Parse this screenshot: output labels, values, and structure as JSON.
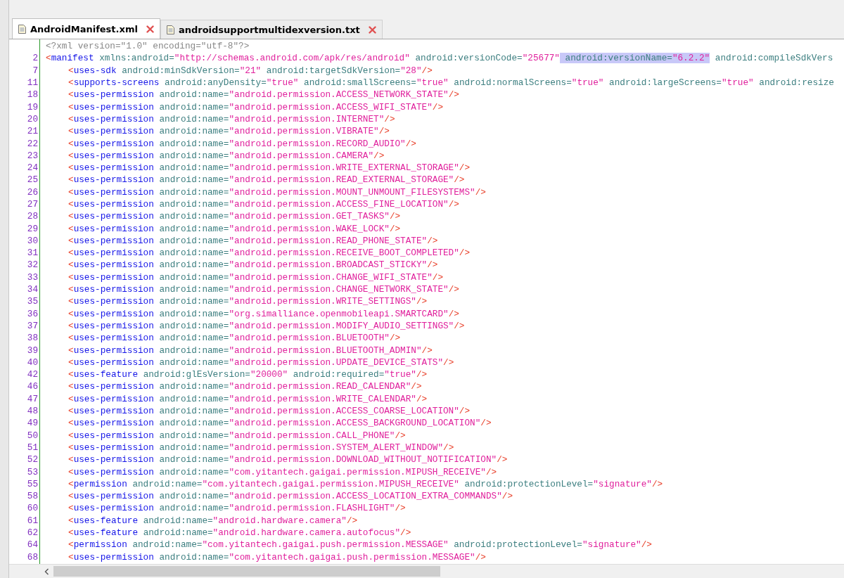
{
  "tabs": [
    {
      "label": "AndroidManifest.xml",
      "selected": true
    },
    {
      "label": "androidsupportmultidexversion.txt",
      "selected": false
    }
  ],
  "editor": {
    "lines": [
      {
        "kind": "declaration",
        "text": "<?xml version=\"1.0\" encoding=\"utf-8\"?>"
      },
      {
        "kind": "element",
        "number": "2",
        "open": "<",
        "tag": "manifest",
        "attrs": [
          {
            "name": "xmlns:android=",
            "value": "\"http://schemas.android.com/apk/res/android\"",
            "selected": false
          },
          {
            "name": "android:versionCode=",
            "value": "\"25677\"",
            "selected": false
          },
          {
            "name": "android:versionName=",
            "value": "\"6.2.2\"",
            "selected": true
          },
          {
            "name": "android:compileSdkVers",
            "selected": false
          }
        ],
        "children": [
          {
            "kind": "element",
            "number": "7",
            "open": "<",
            "tag": "uses-sdk",
            "attrs": [
              {
                "name": "android:minSdkVersion=",
                "value": "\"21\"",
                "selected": false
              },
              {
                "name": "android:targetSdkVersion=",
                "value": "\"28\"",
                "selected": false
              }
            ],
            "end": "/>"
          },
          {
            "kind": "element",
            "number": "11",
            "open": "<",
            "tag": "supports-screens",
            "attrs": [
              {
                "name": "android:anyDensity=",
                "value": "\"true\"",
                "selected": false
              },
              {
                "name": "android:smallScreens=",
                "value": "\"true\"",
                "selected": false
              },
              {
                "name": "android:normalScreens=",
                "value": "\"true\"",
                "selected": false
              },
              {
                "name": "android:largeScreens=",
                "value": "\"true\"",
                "selected": false
              },
              {
                "name": "android:resize",
                "selected": false
              }
            ]
          },
          {
            "kind": "element",
            "number": "18",
            "open": "<",
            "tag": "uses-permission",
            "attrs": [
              {
                "name": "android:name=",
                "value": "\"android.permission.ACCESS_NETWORK_STATE\"",
                "selected": false
              }
            ],
            "end": "/>"
          },
          {
            "kind": "element",
            "number": "19",
            "open": "<",
            "tag": "uses-permission",
            "attrs": [
              {
                "name": "android:name=",
                "value": "\"android.permission.ACCESS_WIFI_STATE\"",
                "selected": false
              }
            ],
            "end": "/>"
          },
          {
            "kind": "element",
            "number": "20",
            "open": "<",
            "tag": "uses-permission",
            "attrs": [
              {
                "name": "android:name=",
                "value": "\"android.permission.INTERNET\"",
                "selected": false
              }
            ],
            "end": "/>"
          },
          {
            "kind": "element",
            "number": "21",
            "open": "<",
            "tag": "uses-permission",
            "attrs": [
              {
                "name": "android:name=",
                "value": "\"android.permission.VIBRATE\"",
                "selected": false
              }
            ],
            "end": "/>"
          },
          {
            "kind": "element",
            "number": "22",
            "open": "<",
            "tag": "uses-permission",
            "attrs": [
              {
                "name": "android:name=",
                "value": "\"android.permission.RECORD_AUDIO\"",
                "selected": false
              }
            ],
            "end": "/>"
          },
          {
            "kind": "element",
            "number": "23",
            "open": "<",
            "tag": "uses-permission",
            "attrs": [
              {
                "name": "android:name=",
                "value": "\"android.permission.CAMERA\"",
                "selected": false
              }
            ],
            "end": "/>"
          },
          {
            "kind": "element",
            "number": "24",
            "open": "<",
            "tag": "uses-permission",
            "attrs": [
              {
                "name": "android:name=",
                "value": "\"android.permission.WRITE_EXTERNAL_STORAGE\"",
                "selected": false
              }
            ],
            "end": "/>"
          },
          {
            "kind": "element",
            "number": "25",
            "open": "<",
            "tag": "uses-permission",
            "attrs": [
              {
                "name": "android:name=",
                "value": "\"android.permission.READ_EXTERNAL_STORAGE\"",
                "selected": false
              }
            ],
            "end": "/>"
          },
          {
            "kind": "element",
            "number": "26",
            "open": "<",
            "tag": "uses-permission",
            "attrs": [
              {
                "name": "android:name=",
                "value": "\"android.permission.MOUNT_UNMOUNT_FILESYSTEMS\"",
                "selected": false
              }
            ],
            "end": "/>"
          },
          {
            "kind": "element",
            "number": "27",
            "open": "<",
            "tag": "uses-permission",
            "attrs": [
              {
                "name": "android:name=",
                "value": "\"android.permission.ACCESS_FINE_LOCATION\"",
                "selected": false
              }
            ],
            "end": "/>"
          },
          {
            "kind": "element",
            "number": "28",
            "open": "<",
            "tag": "uses-permission",
            "attrs": [
              {
                "name": "android:name=",
                "value": "\"android.permission.GET_TASKS\"",
                "selected": false
              }
            ],
            "end": "/>"
          },
          {
            "kind": "element",
            "number": "29",
            "open": "<",
            "tag": "uses-permission",
            "attrs": [
              {
                "name": "android:name=",
                "value": "\"android.permission.WAKE_LOCK\"",
                "selected": false
              }
            ],
            "end": "/>"
          },
          {
            "kind": "element",
            "number": "30",
            "open": "<",
            "tag": "uses-permission",
            "attrs": [
              {
                "name": "android:name=",
                "value": "\"android.permission.READ_PHONE_STATE\"",
                "selected": false
              }
            ],
            "end": "/>"
          },
          {
            "kind": "element",
            "number": "31",
            "open": "<",
            "tag": "uses-permission",
            "attrs": [
              {
                "name": "android:name=",
                "value": "\"android.permission.RECEIVE_BOOT_COMPLETED\"",
                "selected": false
              }
            ],
            "end": "/>"
          },
          {
            "kind": "element",
            "number": "32",
            "open": "<",
            "tag": "uses-permission",
            "attrs": [
              {
                "name": "android:name=",
                "value": "\"android.permission.BROADCAST_STICKY\"",
                "selected": false
              }
            ],
            "end": "/>"
          },
          {
            "kind": "element",
            "number": "33",
            "open": "<",
            "tag": "uses-permission",
            "attrs": [
              {
                "name": "android:name=",
                "value": "\"android.permission.CHANGE_WIFI_STATE\"",
                "selected": false
              }
            ],
            "end": "/>"
          },
          {
            "kind": "element",
            "number": "34",
            "open": "<",
            "tag": "uses-permission",
            "attrs": [
              {
                "name": "android:name=",
                "value": "\"android.permission.CHANGE_NETWORK_STATE\"",
                "selected": false
              }
            ],
            "end": "/>"
          },
          {
            "kind": "element",
            "number": "35",
            "open": "<",
            "tag": "uses-permission",
            "attrs": [
              {
                "name": "android:name=",
                "value": "\"android.permission.WRITE_SETTINGS\"",
                "selected": false
              }
            ],
            "end": "/>"
          },
          {
            "kind": "element",
            "number": "36",
            "open": "<",
            "tag": "uses-permission",
            "attrs": [
              {
                "name": "android:name=",
                "value": "\"org.simalliance.openmobileapi.SMARTCARD\"",
                "selected": false
              }
            ],
            "end": "/>"
          },
          {
            "kind": "element",
            "number": "37",
            "open": "<",
            "tag": "uses-permission",
            "attrs": [
              {
                "name": "android:name=",
                "value": "\"android.permission.MODIFY_AUDIO_SETTINGS\"",
                "selected": false
              }
            ],
            "end": "/>"
          },
          {
            "kind": "element",
            "number": "38",
            "open": "<",
            "tag": "uses-permission",
            "attrs": [
              {
                "name": "android:name=",
                "value": "\"android.permission.BLUETOOTH\"",
                "selected": false
              }
            ],
            "end": "/>"
          },
          {
            "kind": "element",
            "number": "39",
            "open": "<",
            "tag": "uses-permission",
            "attrs": [
              {
                "name": "android:name=",
                "value": "\"android.permission.BLUETOOTH_ADMIN\"",
                "selected": false
              }
            ],
            "end": "/>"
          },
          {
            "kind": "element",
            "number": "40",
            "open": "<",
            "tag": "uses-permission",
            "attrs": [
              {
                "name": "android:name=",
                "value": "\"android.permission.UPDATE_DEVICE_STATS\"",
                "selected": false
              }
            ],
            "end": "/>"
          },
          {
            "kind": "element",
            "number": "42",
            "open": "<",
            "tag": "uses-feature",
            "attrs": [
              {
                "name": "android:glEsVersion=",
                "value": "\"20000\"",
                "selected": false
              },
              {
                "name": "android:required=",
                "value": "\"true\"",
                "selected": false
              }
            ],
            "end": "/>"
          },
          {
            "kind": "element",
            "number": "46",
            "open": "<",
            "tag": "uses-permission",
            "attrs": [
              {
                "name": "android:name=",
                "value": "\"android.permission.READ_CALENDAR\"",
                "selected": false
              }
            ],
            "end": "/>"
          },
          {
            "kind": "element",
            "number": "47",
            "open": "<",
            "tag": "uses-permission",
            "attrs": [
              {
                "name": "android:name=",
                "value": "\"android.permission.WRITE_CALENDAR\"",
                "selected": false
              }
            ],
            "end": "/>"
          },
          {
            "kind": "element",
            "number": "48",
            "open": "<",
            "tag": "uses-permission",
            "attrs": [
              {
                "name": "android:name=",
                "value": "\"android.permission.ACCESS_COARSE_LOCATION\"",
                "selected": false
              }
            ],
            "end": "/>"
          },
          {
            "kind": "element",
            "number": "49",
            "open": "<",
            "tag": "uses-permission",
            "attrs": [
              {
                "name": "android:name=",
                "value": "\"android.permission.ACCESS_BACKGROUND_LOCATION\"",
                "selected": false
              }
            ],
            "end": "/>"
          },
          {
            "kind": "element",
            "number": "50",
            "open": "<",
            "tag": "uses-permission",
            "attrs": [
              {
                "name": "android:name=",
                "value": "\"android.permission.CALL_PHONE\"",
                "selected": false
              }
            ],
            "end": "/>"
          },
          {
            "kind": "element",
            "number": "51",
            "open": "<",
            "tag": "uses-permission",
            "attrs": [
              {
                "name": "android:name=",
                "value": "\"android.permission.SYSTEM_ALERT_WINDOW\"",
                "selected": false
              }
            ],
            "end": "/>"
          },
          {
            "kind": "element",
            "number": "52",
            "open": "<",
            "tag": "uses-permission",
            "attrs": [
              {
                "name": "android:name=",
                "value": "\"android.permission.DOWNLOAD_WITHOUT_NOTIFICATION\"",
                "selected": false
              }
            ],
            "end": "/>"
          },
          {
            "kind": "element",
            "number": "53",
            "open": "<",
            "tag": "uses-permission",
            "attrs": [
              {
                "name": "android:name=",
                "value": "\"com.yitantech.gaigai.permission.MIPUSH_RECEIVE\"",
                "selected": false
              }
            ],
            "end": "/>"
          },
          {
            "kind": "element",
            "number": "55",
            "open": "<",
            "tag": "permission",
            "attrs": [
              {
                "name": "android:name=",
                "value": "\"com.yitantech.gaigai.permission.MIPUSH_RECEIVE\"",
                "selected": false
              },
              {
                "name": "android:protectionLevel=",
                "value": "\"signature\"",
                "selected": false
              }
            ],
            "end": "/>"
          },
          {
            "kind": "element",
            "number": "58",
            "open": "<",
            "tag": "uses-permission",
            "attrs": [
              {
                "name": "android:name=",
                "value": "\"android.permission.ACCESS_LOCATION_EXTRA_COMMANDS\"",
                "selected": false
              }
            ],
            "end": "/>"
          },
          {
            "kind": "element",
            "number": "60",
            "open": "<",
            "tag": "uses-permission",
            "attrs": [
              {
                "name": "android:name=",
                "value": "\"android.permission.FLASHLIGHT\"",
                "selected": false
              }
            ],
            "end": "/>"
          },
          {
            "kind": "element",
            "number": "61",
            "open": "<",
            "tag": "uses-feature",
            "attrs": [
              {
                "name": "android:name=",
                "value": "\"android.hardware.camera\"",
                "selected": false
              }
            ],
            "end": "/>"
          },
          {
            "kind": "element",
            "number": "62",
            "open": "<",
            "tag": "uses-feature",
            "attrs": [
              {
                "name": "android:name=",
                "value": "\"android.hardware.camera.autofocus\"",
                "selected": false
              }
            ],
            "end": "/>"
          },
          {
            "kind": "element",
            "number": "64",
            "open": "<",
            "tag": "permission",
            "attrs": [
              {
                "name": "android:name=",
                "value": "\"com.yitantech.gaigai.push.permission.MESSAGE\"",
                "selected": false
              },
              {
                "name": "android:protectionLevel=",
                "value": "\"signature\"",
                "selected": false
              }
            ],
            "end": "/>"
          },
          {
            "kind": "element",
            "number": "68",
            "open": "<",
            "tag": "uses-permission",
            "attrs": [
              {
                "name": "android:name=",
                "value": "\"com.yitantech.gaigai.push.permission.MESSAGE\"",
                "selected": false
              }
            ],
            "end": "/>"
          }
        ]
      }
    ]
  }
}
